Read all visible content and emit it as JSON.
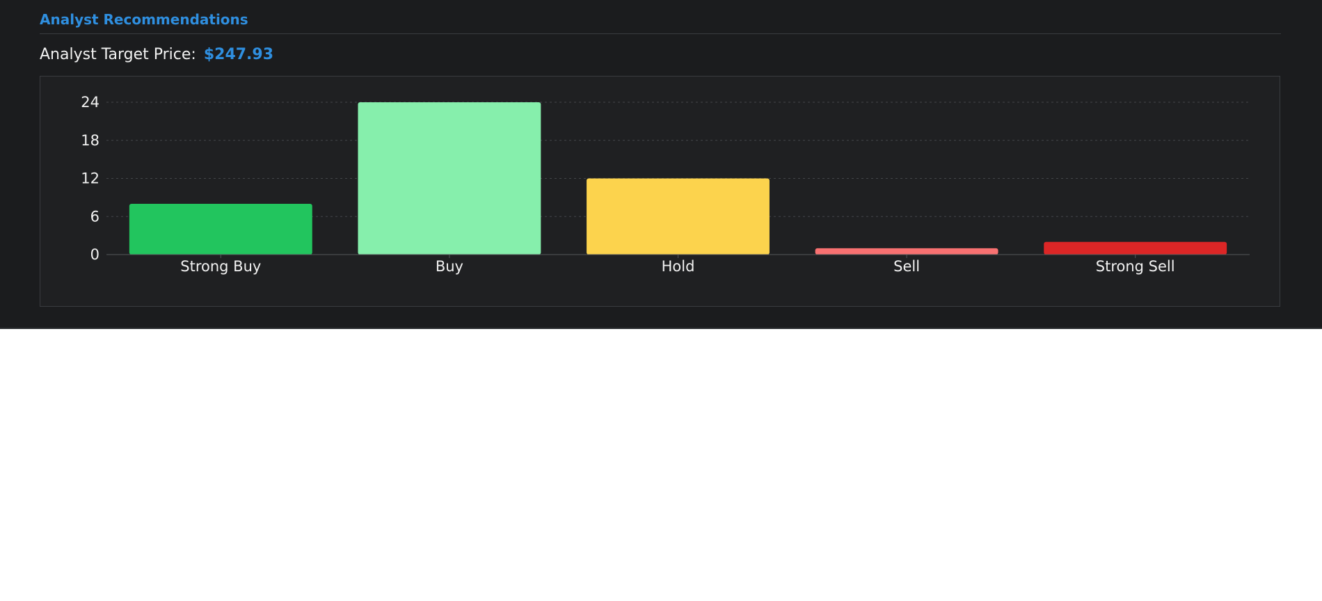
{
  "section": {
    "title": "Analyst Recommendations"
  },
  "target": {
    "label": "Analyst Target Price:",
    "value": "$247.93"
  },
  "chart_data": {
    "type": "bar",
    "categories": [
      "Strong Buy",
      "Buy",
      "Hold",
      "Sell",
      "Strong Sell"
    ],
    "values": [
      8,
      24,
      12,
      1,
      2
    ],
    "colors": [
      "#22c55e",
      "#86efac",
      "#fcd34d",
      "#f87171",
      "#dc2626"
    ],
    "yticks": [
      0,
      6,
      12,
      18,
      24
    ],
    "ylim": [
      0,
      24
    ],
    "grid": true,
    "legend": "none",
    "title": "",
    "xlabel": "",
    "ylabel": ""
  }
}
